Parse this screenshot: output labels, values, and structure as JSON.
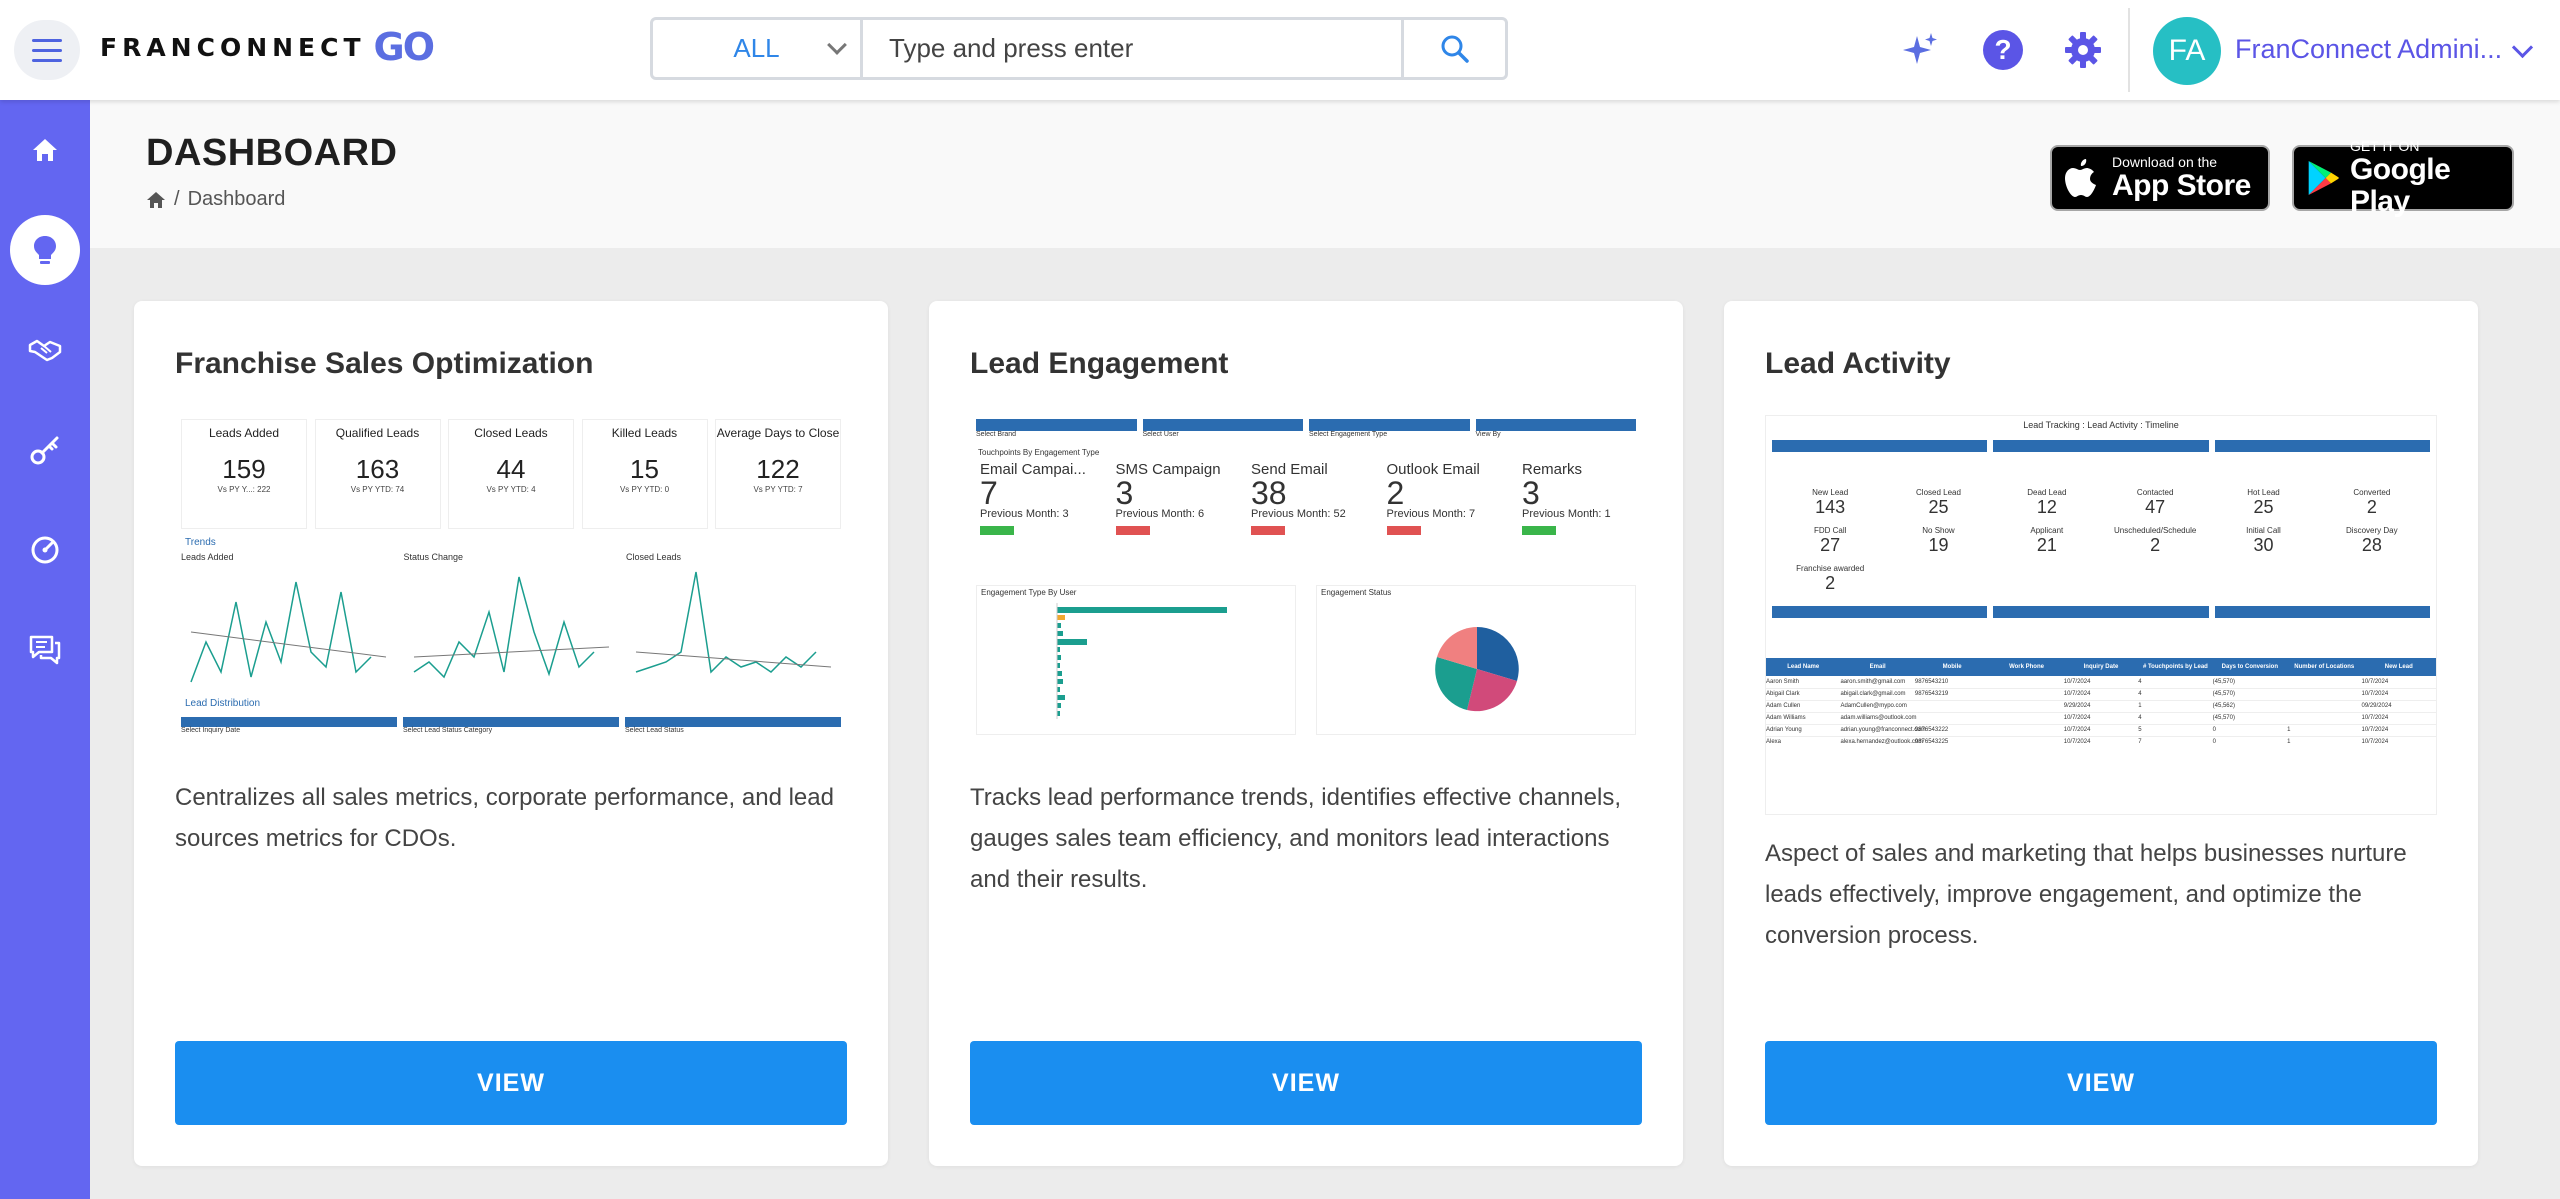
{
  "brand": {
    "logo_text": "FRANCONNECT",
    "logo_go": "GO"
  },
  "search": {
    "category": "ALL",
    "placeholder": "Type and press enter"
  },
  "user": {
    "initials": "FA",
    "name": "FranConnect Admini..."
  },
  "sidebar": {
    "items": [
      "home",
      "lightbulb",
      "handshake",
      "key",
      "gauge",
      "chat"
    ]
  },
  "page": {
    "title": "DASHBOARD",
    "breadcrumb": "Dashboard",
    "app_store": {
      "small": "Download on the",
      "big": "App Store"
    },
    "google_play": {
      "small": "GET IT ON",
      "big": "Google Play"
    }
  },
  "cards": [
    {
      "title": "Franchise Sales Optimization",
      "description": "Centralizes all sales metrics, corporate performance, and lead sources metrics for CDOs.",
      "button": "VIEW",
      "thumb": {
        "kpis": [
          {
            "label": "Leads Added",
            "value": "159",
            "sub": "Vs PY Y...: 222"
          },
          {
            "label": "Qualified Leads",
            "value": "163",
            "sub": "Vs PY YTD: 74"
          },
          {
            "label": "Closed Leads",
            "value": "44",
            "sub": "Vs PY YTD: 4"
          },
          {
            "label": "Killed Leads",
            "value": "15",
            "sub": "Vs PY YTD: 0"
          },
          {
            "label": "Average Days to Close",
            "value": "122",
            "sub": "Vs PY YTD: 7"
          }
        ],
        "trends": "Trends",
        "charts": [
          "Leads Added",
          "Status Change",
          "Closed Leads"
        ],
        "lead_distribution": "Lead Distribution",
        "filters": [
          "Select Inquiry Date",
          "Select Lead Status Category",
          "Select Lead Status"
        ]
      }
    },
    {
      "title": "Lead Engagement",
      "description": "Tracks lead performance trends, identifies effective channels, gauges sales team efficiency, and monitors lead interactions and their results.",
      "button": "VIEW",
      "thumb": {
        "filters": [
          "Select Brand",
          "Select User",
          "Select Engagement Type",
          "View By"
        ],
        "section": "Touchpoints By Engagement Type",
        "metrics": [
          {
            "label": "Email Campai...",
            "value": "7",
            "prev": "Previous Month: 3"
          },
          {
            "label": "SMS Campaign",
            "value": "3",
            "prev": "Previous Month: 6"
          },
          {
            "label": "Send Email",
            "value": "38",
            "prev": "Previous Month: 52"
          },
          {
            "label": "Outlook Email",
            "value": "2",
            "prev": "Previous Month: 7"
          },
          {
            "label": "Remarks",
            "value": "3",
            "prev": "Previous Month: 1"
          }
        ],
        "bar_title": "Engagement Type By User",
        "pie_title": "Engagement Status"
      }
    },
    {
      "title": "Lead Activity",
      "description": "Aspect of sales and marketing that helps businesses nurture leads effectively, improve engagement, and optimize the conversion process.",
      "button": "VIEW",
      "thumb": {
        "header": "Lead Tracking : Lead Activity : Timeline",
        "stats": [
          {
            "label": "New Lead",
            "value": "143"
          },
          {
            "label": "Closed Lead",
            "value": "25"
          },
          {
            "label": "Dead Lead",
            "value": "12"
          },
          {
            "label": "Contacted",
            "value": "47"
          },
          {
            "label": "Hot Lead",
            "value": "25"
          },
          {
            "label": "Converted",
            "value": "2"
          },
          {
            "label": "FDD Call",
            "value": "27"
          },
          {
            "label": "No Show",
            "value": "19"
          },
          {
            "label": "Applicant",
            "value": "21"
          },
          {
            "label": "Unscheduled/Schedule",
            "value": "2"
          },
          {
            "label": "Initial Call",
            "value": "30"
          },
          {
            "label": "Discovery Day",
            "value": "28"
          },
          {
            "label": "Franchise awarded",
            "value": "2"
          }
        ],
        "table_headers": [
          "Lead Name",
          "Email",
          "Mobile",
          "Work Phone",
          "Inquiry Date",
          "# Touchpoints by Lead",
          "Days to Conversion",
          "Number of Locations",
          "New Lead"
        ],
        "rows": [
          [
            "Aaron Smith",
            "aaron.smith@gmail.com",
            "9876543210",
            "",
            "10/7/2024",
            "4",
            "(45,570)",
            "",
            "10/7/2024"
          ],
          [
            "Abigail Clark",
            "abigail.clark@gmail.com",
            "9876543219",
            "",
            "10/7/2024",
            "4",
            "(45,570)",
            "",
            "10/7/2024"
          ],
          [
            "Adam Cullen",
            "AdamCullen@mypo.com",
            "",
            "",
            "9/29/2024",
            "1",
            "(45,562)",
            "",
            "09/29/2024"
          ],
          [
            "Adam Williams",
            "adam.williams@outlook.com",
            "",
            "",
            "10/7/2024",
            "4",
            "(45,570)",
            "",
            "10/7/2024"
          ],
          [
            "Adrian Young",
            "adrian.young@franconnect.com",
            "9876543222",
            "",
            "10/7/2024",
            "5",
            "0",
            "1",
            "10/7/2024"
          ],
          [
            "Alexa",
            "alexa.hernandez@outlook.com",
            "9876543225",
            "",
            "10/7/2024",
            "7",
            "0",
            "1",
            "10/7/2024"
          ]
        ]
      }
    }
  ]
}
